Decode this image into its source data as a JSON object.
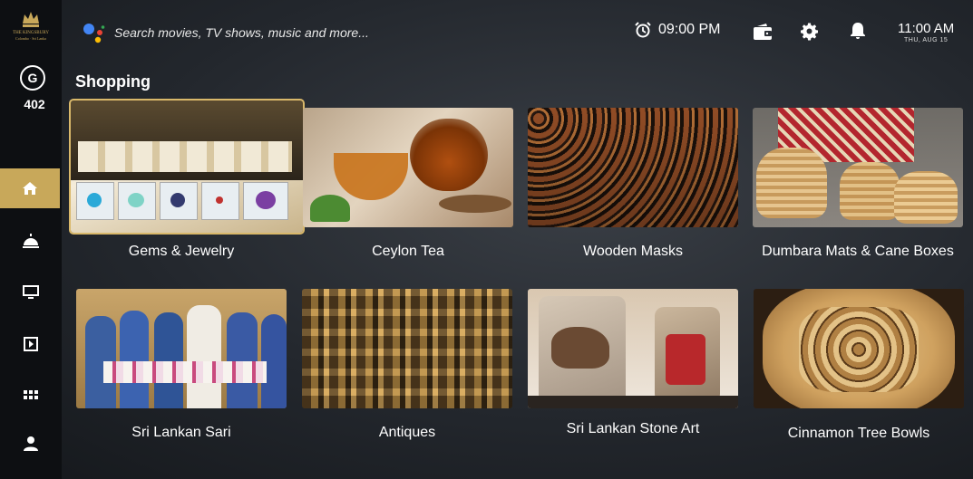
{
  "sidebar": {
    "logo_text": "THE KINGSBURY",
    "logo_subtext": "Colombo · Sri Lanka",
    "avatar_letter": "G",
    "room_number": "402",
    "items": [
      {
        "icon": "home-icon"
      },
      {
        "icon": "room-service-icon"
      },
      {
        "icon": "tv-icon"
      },
      {
        "icon": "play-icon"
      },
      {
        "icon": "apps-grid-icon"
      },
      {
        "icon": "profile-icon"
      }
    ]
  },
  "topbar": {
    "search_placeholder": "Search movies, TV shows, music and more...",
    "alarm_time": "09:00 PM",
    "clock_time": "11:00 AM",
    "clock_date": "THU, AUG 15"
  },
  "section": {
    "title": "Shopping"
  },
  "cards": [
    {
      "label": "Gems & Jewelry"
    },
    {
      "label": "Ceylon Tea"
    },
    {
      "label": "Wooden Masks"
    },
    {
      "label": "Dumbara Mats & Cane Boxes"
    },
    {
      "label": "Sri Lankan Sari"
    },
    {
      "label": "Antiques"
    },
    {
      "label": "Sri Lankan Stone Art"
    },
    {
      "label": "Cinnamon Tree Bowls"
    }
  ],
  "colors": {
    "accent": "#c8a85a",
    "sidebar_bg": "#0d0f12"
  }
}
